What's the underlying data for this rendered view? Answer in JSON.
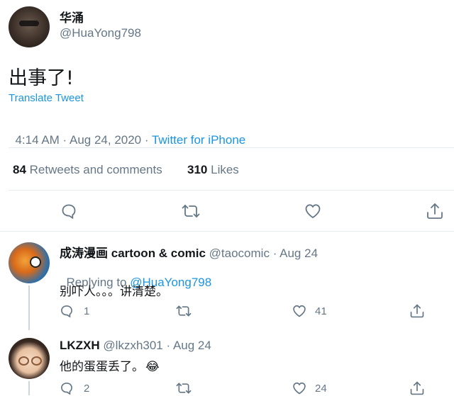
{
  "tweet": {
    "author_name": "华涌",
    "author_handle": "@HuaYong798",
    "text": "出事了!",
    "translate": "Translate Tweet",
    "time": "4:14 AM · Aug 24, 2020 · ",
    "source": "Twitter for iPhone",
    "stats": {
      "retweets_count": "84",
      "retweets_label": "Retweets and comments",
      "likes_count": "310",
      "likes_label": "Likes"
    }
  },
  "replies": [
    {
      "name_cn": "成涛漫画",
      "name_en": "cartoon & comic",
      "handle": "@taocomic",
      "sep": " · ",
      "date": "Aug 24",
      "replying_prefix": "Replying to ",
      "replying_to": "@HuaYong798",
      "text": "别吓人。。。讲清楚。",
      "reply_count": "1",
      "retweet_count": "",
      "like_count": "41"
    },
    {
      "name": "LKZXH",
      "handle": "@lkzxh301",
      "sep": " · ",
      "date": "Aug 24",
      "text": "他的蛋蛋丢了。",
      "emoji": "😂",
      "reply_count": "2",
      "retweet_count": "",
      "like_count": "24"
    }
  ],
  "icons": {
    "reply": "reply-icon",
    "retweet": "retweet-icon",
    "like": "heart-icon",
    "share": "share-icon"
  },
  "colors": {
    "link": "#1b95e0",
    "muted": "#657786",
    "divider": "#e6ecf0"
  }
}
